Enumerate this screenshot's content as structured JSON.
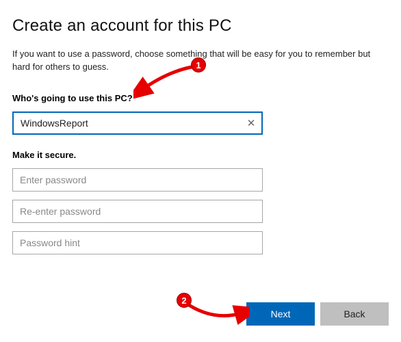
{
  "title": "Create an account for this PC",
  "subtitle": "If you want to use a password, choose something that will be easy for you to remember but hard for others to guess.",
  "who_label": "Who's going to use this PC?",
  "username_value": "WindowsReport",
  "secure_label": "Make it secure.",
  "password_placeholder": "Enter password",
  "confirm_placeholder": "Re-enter password",
  "hint_placeholder": "Password hint",
  "buttons": {
    "next": "Next",
    "back": "Back"
  },
  "annotations": {
    "badge1": "1",
    "badge2": "2"
  }
}
